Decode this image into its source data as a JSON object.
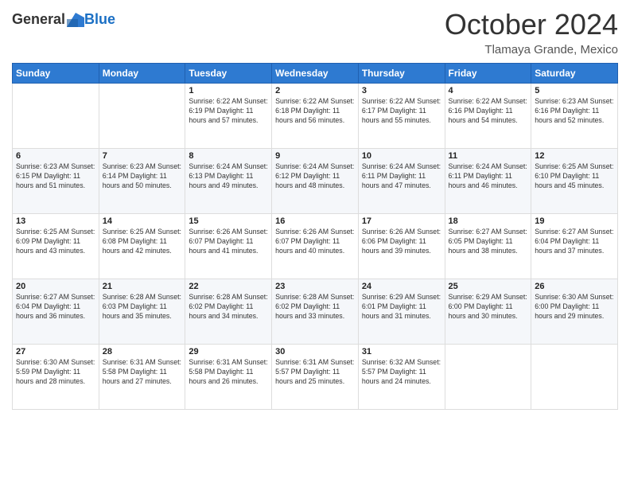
{
  "header": {
    "logo_general": "General",
    "logo_blue": "Blue",
    "month": "October 2024",
    "location": "Tlamaya Grande, Mexico"
  },
  "calendar": {
    "days_of_week": [
      "Sunday",
      "Monday",
      "Tuesday",
      "Wednesday",
      "Thursday",
      "Friday",
      "Saturday"
    ],
    "weeks": [
      [
        {
          "day": "",
          "content": ""
        },
        {
          "day": "",
          "content": ""
        },
        {
          "day": "1",
          "content": "Sunrise: 6:22 AM\nSunset: 6:19 PM\nDaylight: 11 hours and 57 minutes."
        },
        {
          "day": "2",
          "content": "Sunrise: 6:22 AM\nSunset: 6:18 PM\nDaylight: 11 hours and 56 minutes."
        },
        {
          "day": "3",
          "content": "Sunrise: 6:22 AM\nSunset: 6:17 PM\nDaylight: 11 hours and 55 minutes."
        },
        {
          "day": "4",
          "content": "Sunrise: 6:22 AM\nSunset: 6:16 PM\nDaylight: 11 hours and 54 minutes."
        },
        {
          "day": "5",
          "content": "Sunrise: 6:23 AM\nSunset: 6:16 PM\nDaylight: 11 hours and 52 minutes."
        }
      ],
      [
        {
          "day": "6",
          "content": "Sunrise: 6:23 AM\nSunset: 6:15 PM\nDaylight: 11 hours and 51 minutes."
        },
        {
          "day": "7",
          "content": "Sunrise: 6:23 AM\nSunset: 6:14 PM\nDaylight: 11 hours and 50 minutes."
        },
        {
          "day": "8",
          "content": "Sunrise: 6:24 AM\nSunset: 6:13 PM\nDaylight: 11 hours and 49 minutes."
        },
        {
          "day": "9",
          "content": "Sunrise: 6:24 AM\nSunset: 6:12 PM\nDaylight: 11 hours and 48 minutes."
        },
        {
          "day": "10",
          "content": "Sunrise: 6:24 AM\nSunset: 6:11 PM\nDaylight: 11 hours and 47 minutes."
        },
        {
          "day": "11",
          "content": "Sunrise: 6:24 AM\nSunset: 6:11 PM\nDaylight: 11 hours and 46 minutes."
        },
        {
          "day": "12",
          "content": "Sunrise: 6:25 AM\nSunset: 6:10 PM\nDaylight: 11 hours and 45 minutes."
        }
      ],
      [
        {
          "day": "13",
          "content": "Sunrise: 6:25 AM\nSunset: 6:09 PM\nDaylight: 11 hours and 43 minutes."
        },
        {
          "day": "14",
          "content": "Sunrise: 6:25 AM\nSunset: 6:08 PM\nDaylight: 11 hours and 42 minutes."
        },
        {
          "day": "15",
          "content": "Sunrise: 6:26 AM\nSunset: 6:07 PM\nDaylight: 11 hours and 41 minutes."
        },
        {
          "day": "16",
          "content": "Sunrise: 6:26 AM\nSunset: 6:07 PM\nDaylight: 11 hours and 40 minutes."
        },
        {
          "day": "17",
          "content": "Sunrise: 6:26 AM\nSunset: 6:06 PM\nDaylight: 11 hours and 39 minutes."
        },
        {
          "day": "18",
          "content": "Sunrise: 6:27 AM\nSunset: 6:05 PM\nDaylight: 11 hours and 38 minutes."
        },
        {
          "day": "19",
          "content": "Sunrise: 6:27 AM\nSunset: 6:04 PM\nDaylight: 11 hours and 37 minutes."
        }
      ],
      [
        {
          "day": "20",
          "content": "Sunrise: 6:27 AM\nSunset: 6:04 PM\nDaylight: 11 hours and 36 minutes."
        },
        {
          "day": "21",
          "content": "Sunrise: 6:28 AM\nSunset: 6:03 PM\nDaylight: 11 hours and 35 minutes."
        },
        {
          "day": "22",
          "content": "Sunrise: 6:28 AM\nSunset: 6:02 PM\nDaylight: 11 hours and 34 minutes."
        },
        {
          "day": "23",
          "content": "Sunrise: 6:28 AM\nSunset: 6:02 PM\nDaylight: 11 hours and 33 minutes."
        },
        {
          "day": "24",
          "content": "Sunrise: 6:29 AM\nSunset: 6:01 PM\nDaylight: 11 hours and 31 minutes."
        },
        {
          "day": "25",
          "content": "Sunrise: 6:29 AM\nSunset: 6:00 PM\nDaylight: 11 hours and 30 minutes."
        },
        {
          "day": "26",
          "content": "Sunrise: 6:30 AM\nSunset: 6:00 PM\nDaylight: 11 hours and 29 minutes."
        }
      ],
      [
        {
          "day": "27",
          "content": "Sunrise: 6:30 AM\nSunset: 5:59 PM\nDaylight: 11 hours and 28 minutes."
        },
        {
          "day": "28",
          "content": "Sunrise: 6:31 AM\nSunset: 5:58 PM\nDaylight: 11 hours and 27 minutes."
        },
        {
          "day": "29",
          "content": "Sunrise: 6:31 AM\nSunset: 5:58 PM\nDaylight: 11 hours and 26 minutes."
        },
        {
          "day": "30",
          "content": "Sunrise: 6:31 AM\nSunset: 5:57 PM\nDaylight: 11 hours and 25 minutes."
        },
        {
          "day": "31",
          "content": "Sunrise: 6:32 AM\nSunset: 5:57 PM\nDaylight: 11 hours and 24 minutes."
        },
        {
          "day": "",
          "content": ""
        },
        {
          "day": "",
          "content": ""
        }
      ]
    ]
  }
}
